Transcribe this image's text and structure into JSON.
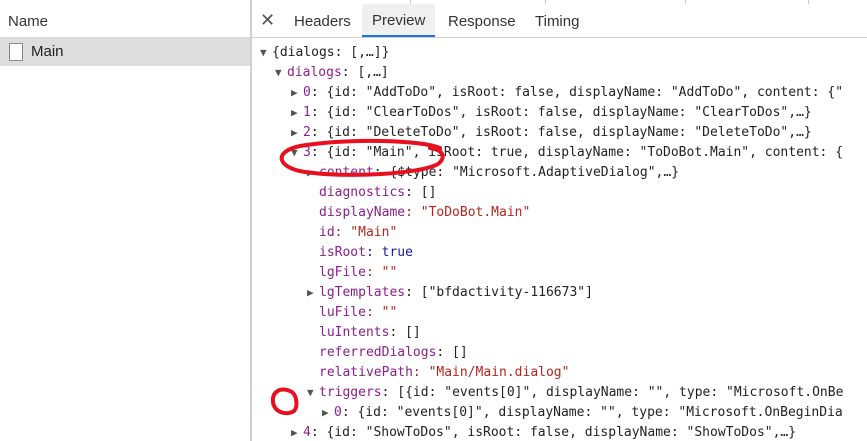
{
  "left": {
    "header": "Name",
    "request": "Main"
  },
  "tabs": [
    "Headers",
    "Preview",
    "Response",
    "Timing"
  ],
  "active_tab": "Preview",
  "preview": {
    "lines": [
      {
        "arrow": "▼",
        "key": "",
        "text": "{dialogs: [,…]}"
      },
      {
        "arrow": "▼",
        "key": "dialogs",
        "text": ": [,…]"
      },
      {
        "arrow": "▶",
        "key": "0",
        "text": ": {id: \"AddToDo\", isRoot: false, displayName: \"AddToDo\", content: {\""
      },
      {
        "arrow": "▶",
        "key": "1",
        "text": ": {id: \"ClearToDos\", isRoot: false, displayName: \"ClearToDos\",…}"
      },
      {
        "arrow": "▶",
        "key": "2",
        "text": ": {id: \"DeleteToDo\", isRoot: false, displayName: \"DeleteToDo\",…}"
      },
      {
        "arrow": "▼",
        "key": "3",
        "text": ": {id: \"Main\", isRoot: true, displayName: \"ToDoBot.Main\", content: {"
      },
      {
        "arrow": "▶",
        "key": "content",
        "text": ": {$type: \"Microsoft.AdaptiveDialog\",…}"
      },
      {
        "arrow": "",
        "key": "diagnostics",
        "text": ": []"
      },
      {
        "arrow": "",
        "key": "displayName",
        "text": ": \"ToDoBot.Main\""
      },
      {
        "arrow": "",
        "key": "id",
        "text": ": \"Main\""
      },
      {
        "arrow": "",
        "key": "isRoot",
        "text": ": true"
      },
      {
        "arrow": "",
        "key": "lgFile",
        "text": ": \"\""
      },
      {
        "arrow": "▶",
        "key": "lgTemplates",
        "text": ": [\"bfdactivity-116673\"]"
      },
      {
        "arrow": "",
        "key": "luFile",
        "text": ": \"\""
      },
      {
        "arrow": "",
        "key": "luIntents",
        "text": ": []"
      },
      {
        "arrow": "",
        "key": "referredDialogs",
        "text": ": []"
      },
      {
        "arrow": "",
        "key": "relativePath",
        "text": ": \"Main/Main.dialog\""
      },
      {
        "arrow": "▼",
        "key": "triggers",
        "text": ": [{id: \"events[0]\", displayName: \"\", type: \"Microsoft.OnBe"
      },
      {
        "arrow": "▶",
        "key": "0",
        "text": ": {id: \"events[0]\", displayName: \"\", type: \"Microsoft.OnBeginDia"
      },
      {
        "arrow": "▶",
        "key": "4",
        "text": ": {id: \"ShowToDos\", isRoot: false, displayName: \"ShowToDos\",…}"
      }
    ]
  },
  "colors": {
    "key": "#8b1f8b",
    "string": "#b3261e",
    "keyword": "#1a1aa6",
    "active_tab_underline": "#1a73e8",
    "annotation": "#e8101e"
  }
}
